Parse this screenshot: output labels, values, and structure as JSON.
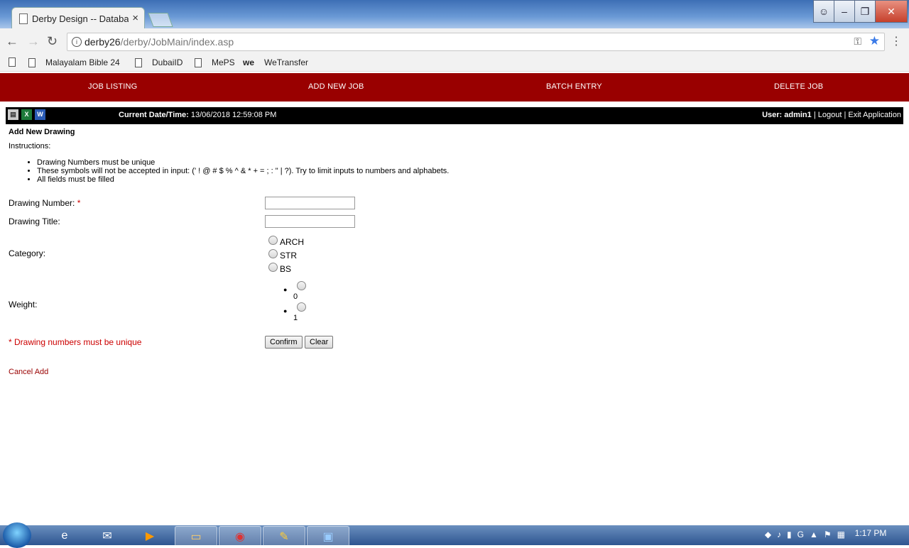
{
  "browser": {
    "tab_title": "Derby Design -- Databas",
    "tab_close": "×",
    "url_host": "derby26",
    "url_path": "/derby/JobMain/index.asp",
    "bookmarks": [
      "Malayalam Bible 24",
      "DubaiID",
      "MePS",
      "WeTransfer"
    ],
    "we_logo": "we"
  },
  "app": {
    "nav": [
      "JOB LISTING",
      "ADD NEW JOB",
      "BATCH ENTRY",
      "DELETE JOB"
    ],
    "datetime_label": "Current Date/Time:",
    "datetime_value": "13/06/2018 12:59:08 PM",
    "user_label": "User: admin1",
    "sep": "|",
    "logout": "Logout",
    "exit": "Exit Application"
  },
  "form": {
    "title": "Add New Drawing",
    "instructions_label": "Instructions:",
    "instructions": [
      "Drawing Numbers must be unique",
      "These symbols will not be accepted in input: (' ! @ # $ % ^ & * + = ; : \" | ?). Try to limit inputs to numbers and alphabets.",
      "All fields must be filled"
    ],
    "drawing_number_label": "Drawing Number:",
    "required_mark": "*",
    "drawing_title_label": "Drawing Title:",
    "category_label": "Category:",
    "categories": [
      "ARCH",
      "STR",
      "BS"
    ],
    "weight_label": "Weight:",
    "weights": [
      "0",
      "1"
    ],
    "unique_note": "* Drawing numbers must be unique",
    "confirm": "Confirm",
    "clear": "Clear",
    "cancel": "Cancel Add"
  },
  "taskbar": {
    "time": "1:17 PM"
  }
}
